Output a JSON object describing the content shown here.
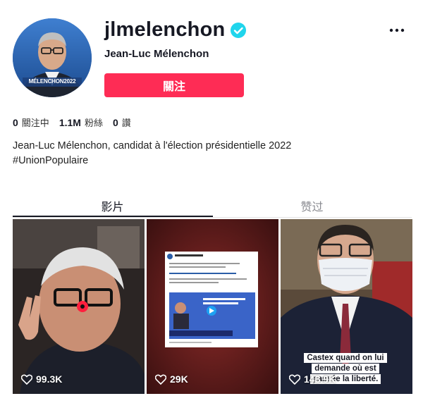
{
  "profile": {
    "username": "jlmelenchon",
    "display_name": "Jean-Luc Mélenchon",
    "avatar_badge": "MÉLENCHON2022",
    "follow_label": "關注",
    "verified_icon": "verified-badge-icon"
  },
  "stats": [
    {
      "value": "0",
      "label": "關注中"
    },
    {
      "value": "1.1M",
      "label": "粉絲"
    },
    {
      "value": "0",
      "label": "讚"
    }
  ],
  "bio": {
    "line1": "Jean-Luc Mélenchon, candidat à l'élection présidentielle 2022",
    "line2": "#UnionPopulaire"
  },
  "tabs": [
    {
      "label": "影片",
      "active": true
    },
    {
      "label": "赞过",
      "active": false
    }
  ],
  "videos": [
    {
      "likes": "99.3K",
      "caption": ""
    },
    {
      "likes": "29K",
      "caption": ""
    },
    {
      "likes": "148.9K",
      "caption": "Castex quand on lui demande où est passée la liberté."
    }
  ],
  "colors": {
    "accent": "#fe2c55",
    "verified": "#20d5ec",
    "text": "#161823"
  }
}
